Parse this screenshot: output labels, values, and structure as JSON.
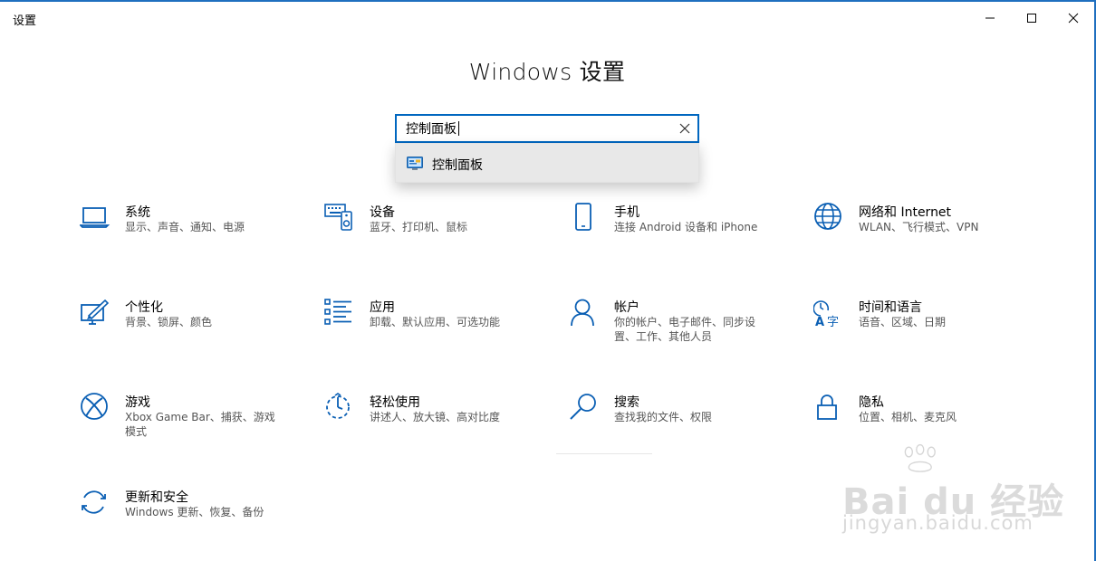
{
  "window": {
    "title": "设置",
    "controls": [
      "minimize",
      "maximize",
      "close"
    ]
  },
  "header": {
    "title": "Windows 设置"
  },
  "search": {
    "value": "控制面板",
    "placeholder": "",
    "suggestion": "控制面板"
  },
  "tiles": [
    {
      "title": "系统",
      "desc": "显示、声音、通知、电源",
      "icon": "laptop-icon"
    },
    {
      "title": "设备",
      "desc": "蓝牙、打印机、鼠标",
      "icon": "devices-icon"
    },
    {
      "title": "手机",
      "desc": "连接 Android 设备和 iPhone",
      "icon": "phone-icon"
    },
    {
      "title": "网络和 Internet",
      "desc": "WLAN、飞行模式、VPN",
      "icon": "globe-icon"
    },
    {
      "title": "个性化",
      "desc": "背景、锁屏、颜色",
      "icon": "personalize-icon"
    },
    {
      "title": "应用",
      "desc": "卸载、默认应用、可选功能",
      "icon": "apps-list-icon"
    },
    {
      "title": "帐户",
      "desc": "你的帐户、电子邮件、同步设置、工作、其他人员",
      "icon": "person-icon"
    },
    {
      "title": "时间和语言",
      "desc": "语音、区域、日期",
      "icon": "time-language-icon"
    },
    {
      "title": "游戏",
      "desc": "Xbox Game Bar、捕获、游戏模式",
      "icon": "xbox-icon"
    },
    {
      "title": "轻松使用",
      "desc": "讲述人、放大镜、高对比度",
      "icon": "ease-of-access-icon"
    },
    {
      "title": "搜索",
      "desc": "查找我的文件、权限",
      "icon": "search-icon"
    },
    {
      "title": "隐私",
      "desc": "位置、相机、麦克风",
      "icon": "lock-icon"
    },
    {
      "title": "更新和安全",
      "desc": "Windows 更新、恢复、备份",
      "icon": "update-icon"
    }
  ],
  "watermark": {
    "brand": "Bai du 经验",
    "url": "jingyan.baidu.com"
  },
  "colors": {
    "accent": "#0067c0",
    "frame": "#1f6fbf",
    "icon": "#0a5fb4"
  }
}
